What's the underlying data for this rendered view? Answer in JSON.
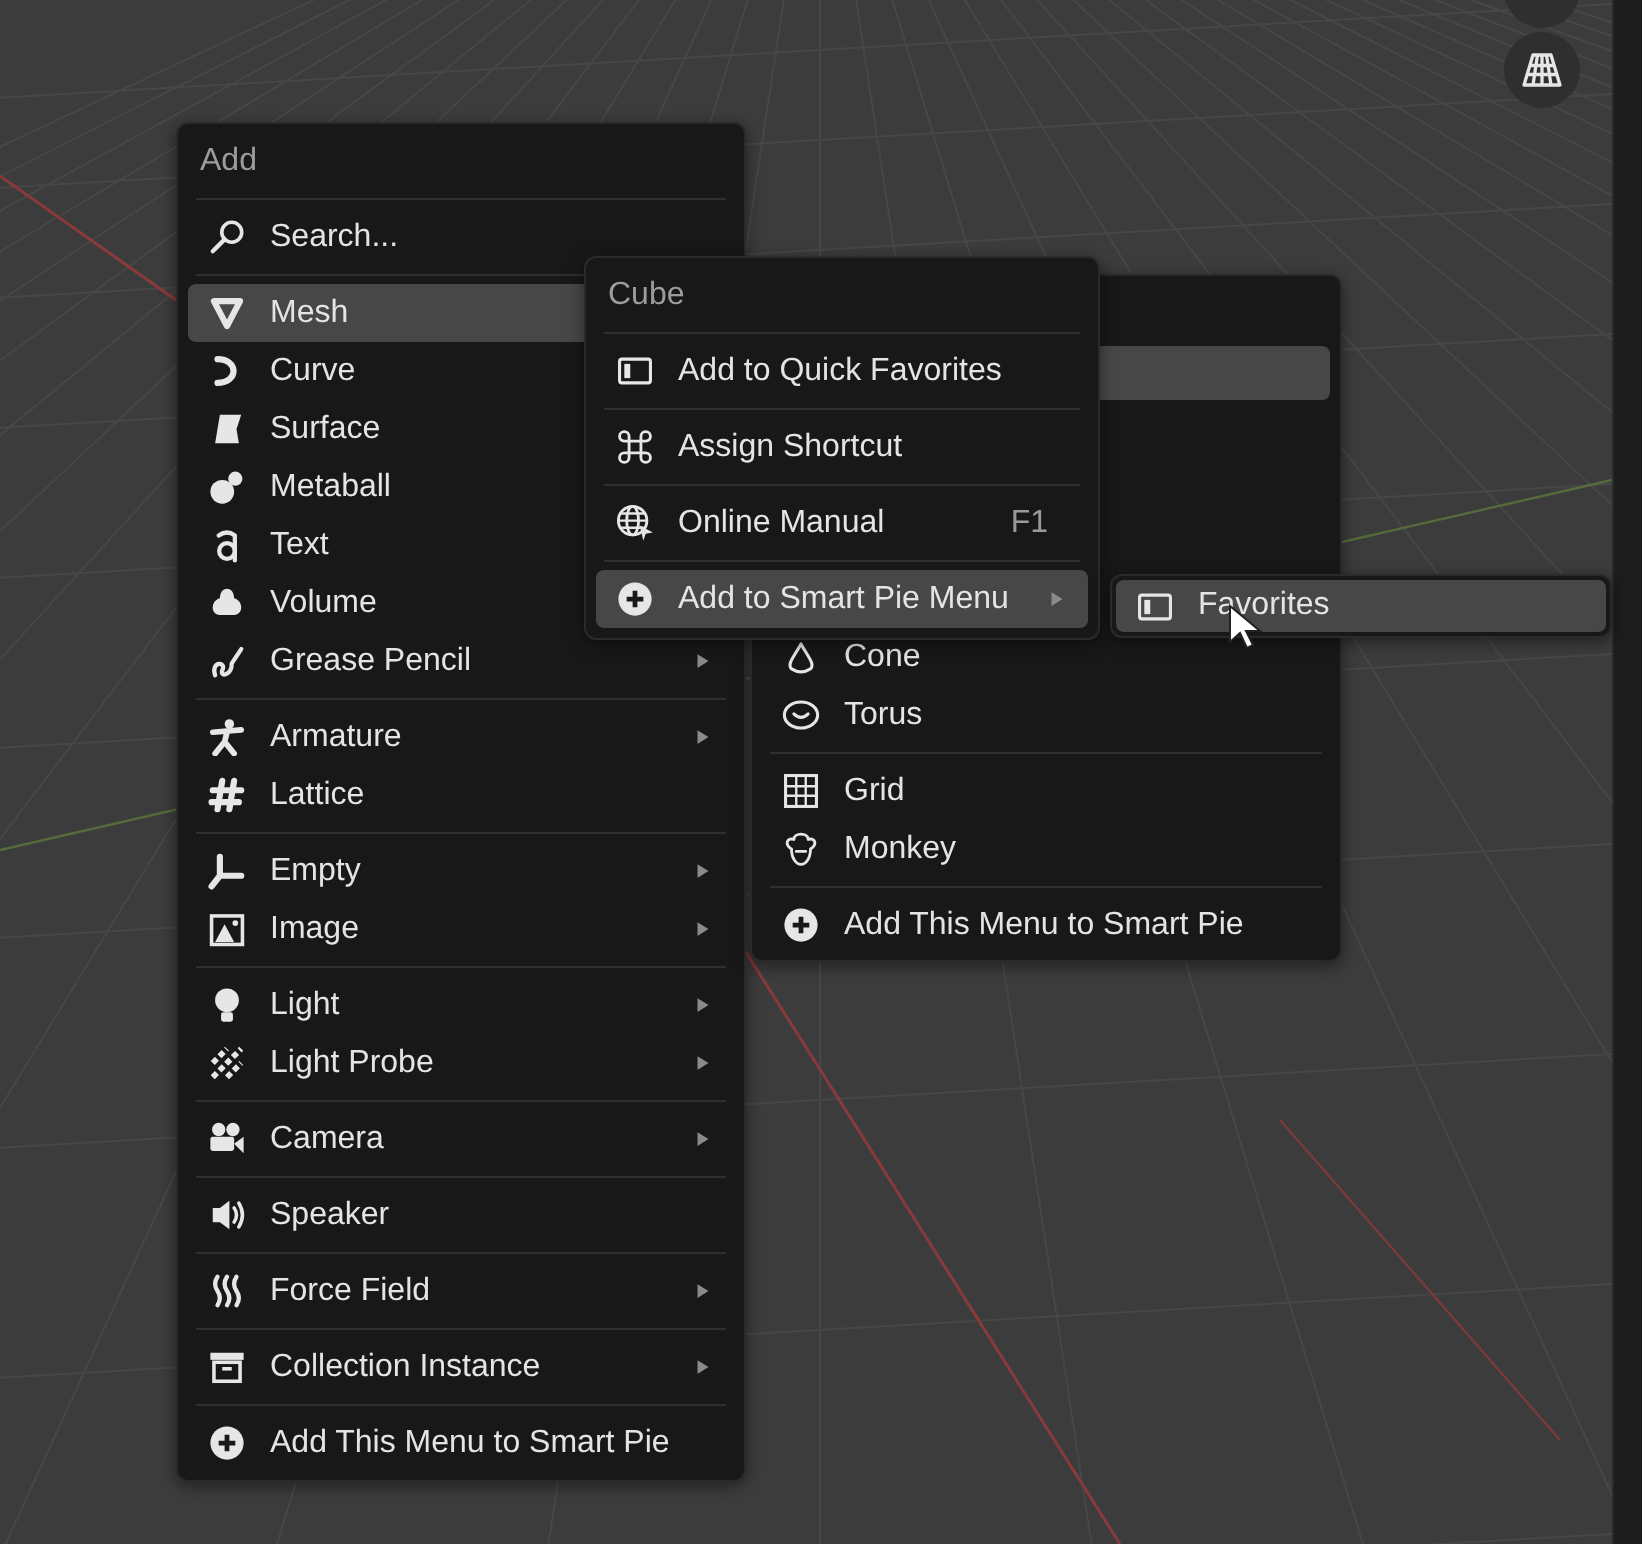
{
  "add_menu": {
    "title": "Add",
    "search": {
      "label": "Search..."
    },
    "groups": [
      [
        {
          "label": "Mesh",
          "selected": true
        },
        {
          "label": "Curve",
          "selected": false
        },
        {
          "label": "Surface",
          "selected": false
        },
        {
          "label": "Metaball",
          "selected": false
        },
        {
          "label": "Text",
          "selected": false
        },
        {
          "label": "Volume",
          "selected": false
        },
        {
          "label": "Grease Pencil",
          "has_submenu": true,
          "selected": false
        }
      ],
      [
        {
          "label": "Armature",
          "has_submenu": true,
          "selected": false
        },
        {
          "label": "Lattice",
          "has_submenu": false,
          "selected": false
        }
      ],
      [
        {
          "label": "Empty",
          "has_submenu": true,
          "selected": false
        },
        {
          "label": "Image",
          "has_submenu": true,
          "selected": false
        }
      ],
      [
        {
          "label": "Light",
          "has_submenu": true,
          "selected": false
        },
        {
          "label": "Light Probe",
          "has_submenu": true,
          "selected": false
        }
      ],
      [
        {
          "label": "Camera",
          "has_submenu": true,
          "selected": false
        }
      ],
      [
        {
          "label": "Speaker",
          "has_submenu": false,
          "selected": false
        }
      ],
      [
        {
          "label": "Force Field",
          "has_submenu": true,
          "selected": false
        }
      ],
      [
        {
          "label": "Collection Instance",
          "has_submenu": true,
          "selected": false
        }
      ]
    ],
    "footer": "Add This Menu to Smart Pie"
  },
  "mesh_submenu": {
    "highlighted_row": true,
    "groups": [
      [
        {
          "label": "Cone",
          "selected": false
        },
        {
          "label": "Torus",
          "selected": false
        }
      ],
      [
        {
          "label": "Grid",
          "selected": false
        },
        {
          "label": "Monkey",
          "selected": false
        }
      ]
    ],
    "footer": "Add This Menu to Smart Pie"
  },
  "context_menu": {
    "title": "Cube",
    "items": [
      {
        "label": "Add to Quick Favorites",
        "has_submenu": false,
        "selected": false
      },
      {
        "label": "Assign Shortcut",
        "has_submenu": false,
        "selected": false
      },
      {
        "label": "Online Manual",
        "shortcut": "F1",
        "has_submenu": false,
        "selected": false
      },
      {
        "label": "Add to Smart Pie Menu",
        "has_submenu": true,
        "selected": true
      }
    ]
  },
  "pie_submenu": {
    "items": [
      {
        "label": "Favorites",
        "selected": true
      }
    ]
  }
}
